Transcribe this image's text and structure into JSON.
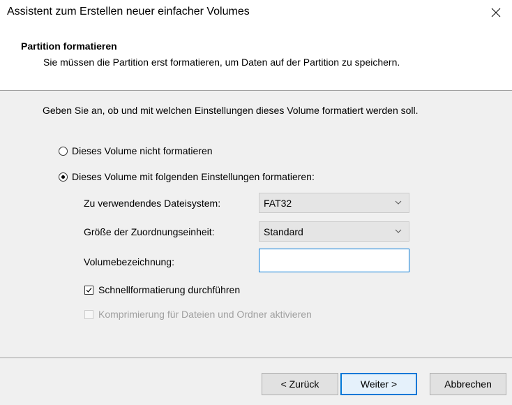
{
  "window": {
    "title": "Assistent zum Erstellen neuer einfacher Volumes",
    "close_icon": "close-icon"
  },
  "header": {
    "title": "Partition formatieren",
    "subtitle": "Sie müssen die Partition erst formatieren, um Daten auf der Partition zu speichern."
  },
  "content": {
    "intro": "Geben Sie an, ob und mit welchen Einstellungen dieses Volume formatiert werden soll.",
    "option_no_format": {
      "label": "Dieses Volume nicht formatieren",
      "selected": false
    },
    "option_format": {
      "label": "Dieses Volume mit folgenden Einstellungen formatieren:",
      "selected": true
    },
    "filesystem": {
      "label": "Zu verwendendes Dateisystem:",
      "value": "FAT32"
    },
    "allocation": {
      "label": "Größe der Zuordnungseinheit:",
      "value": "Standard"
    },
    "volume_label": {
      "label": "Volumebezeichnung:",
      "value": ""
    },
    "quick_format": {
      "label": "Schnellformatierung durchführen",
      "checked": true,
      "enabled": true
    },
    "compression": {
      "label": "Komprimierung für Dateien und Ordner aktivieren",
      "checked": false,
      "enabled": false
    }
  },
  "buttons": {
    "back": "< Zurück",
    "next": "Weiter >",
    "cancel": "Abbrechen"
  },
  "colors": {
    "panel_bg": "#f0f0f0",
    "accent": "#0078d7",
    "disabled_text": "#a0a0a0"
  }
}
